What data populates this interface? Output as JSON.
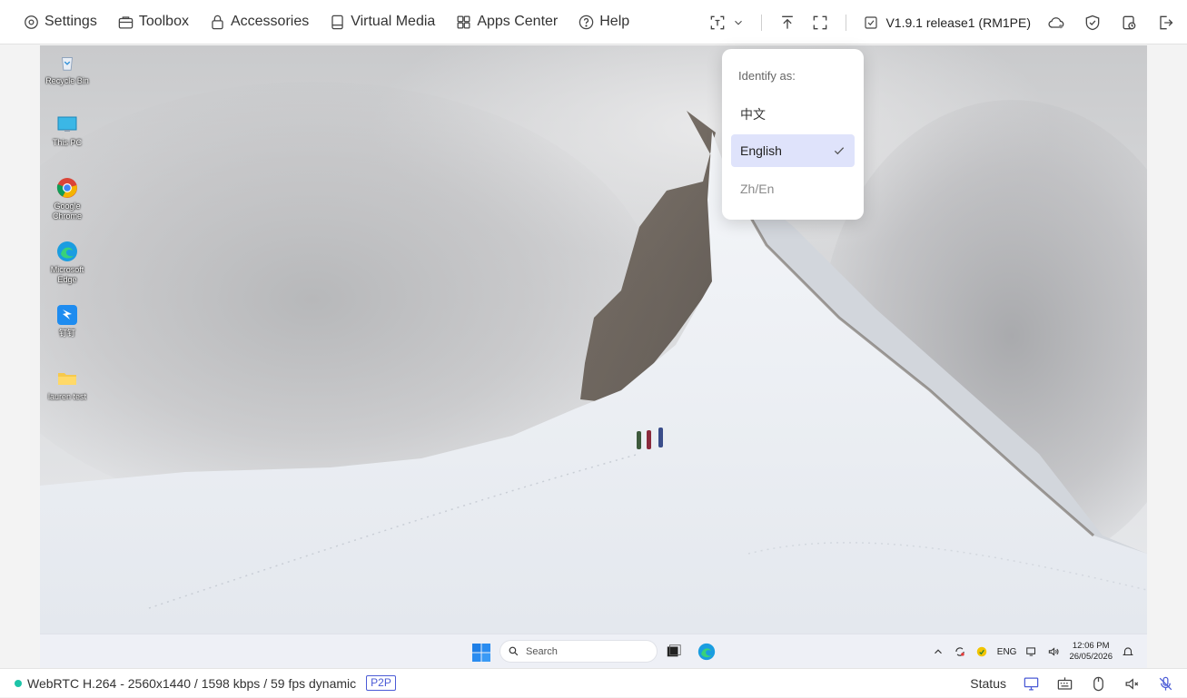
{
  "toolbar": {
    "menu": [
      {
        "label": "Settings",
        "icon": "gear-icon"
      },
      {
        "label": "Toolbox",
        "icon": "toolbox-icon"
      },
      {
        "label": "Accessories",
        "icon": "lock-bag-icon"
      },
      {
        "label": "Virtual Media",
        "icon": "drive-icon"
      },
      {
        "label": "Apps Center",
        "icon": "apps-grid-icon"
      },
      {
        "label": "Help",
        "icon": "help-icon"
      }
    ],
    "version": "V1.9.1 release1 (RM1PE)"
  },
  "dropdown": {
    "title": "Identify as:",
    "options": [
      {
        "label": "中文",
        "selected": false
      },
      {
        "label": "English",
        "selected": true
      },
      {
        "label": "Zh/En",
        "selected": false
      }
    ]
  },
  "desktop_icons": [
    {
      "label": "Recycle Bin",
      "icon": "recycle-bin-icon"
    },
    {
      "label": "This PC",
      "icon": "monitor-icon"
    },
    {
      "label": "Google Chrome",
      "icon": "chrome-icon"
    },
    {
      "label": "Microsoft Edge",
      "icon": "edge-icon"
    },
    {
      "label": "钉钉",
      "icon": "dingtalk-icon"
    },
    {
      "label": "lauren test",
      "icon": "folder-icon"
    }
  ],
  "taskbar": {
    "search_placeholder": "Search",
    "language": "ENG",
    "time": "12:06 PM",
    "date": "26/05/2026"
  },
  "statusbar": {
    "stream_info": "WebRTC H.264 - 2560x1440 / 1598 kbps / 59 fps dynamic",
    "connection_badge": "P2P",
    "status_label": "Status",
    "accent_color": "#4b5bd6",
    "online_color": "#1cc4a8"
  }
}
